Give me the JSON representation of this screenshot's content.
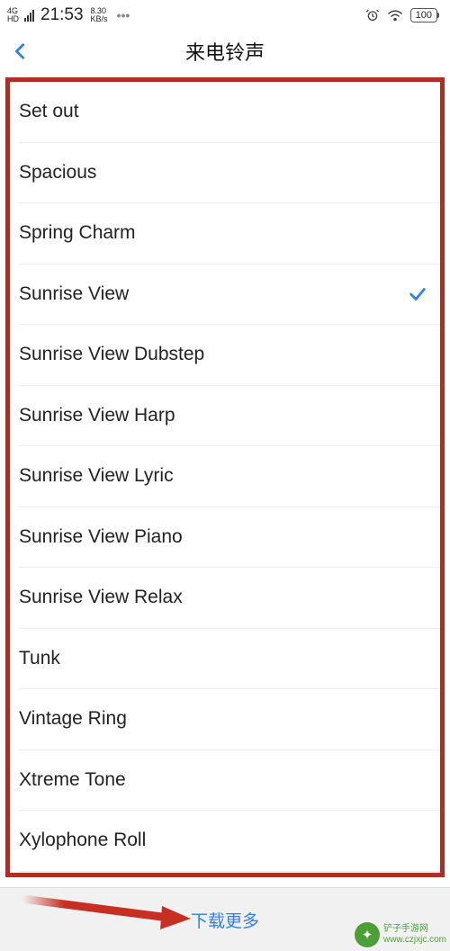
{
  "status": {
    "network_tag_top": "4G",
    "network_tag_bottom": "HD",
    "time": "21:53",
    "speed_top": "8.30",
    "speed_bottom": "KB/s",
    "battery": "100"
  },
  "nav": {
    "title": "来电铃声"
  },
  "ringtones": [
    {
      "label": "Set out",
      "selected": false
    },
    {
      "label": "Spacious",
      "selected": false
    },
    {
      "label": "Spring Charm",
      "selected": false
    },
    {
      "label": "Sunrise View",
      "selected": true
    },
    {
      "label": "Sunrise View Dubstep",
      "selected": false
    },
    {
      "label": "Sunrise View Harp",
      "selected": false
    },
    {
      "label": "Sunrise View Lyric",
      "selected": false
    },
    {
      "label": "Sunrise View Piano",
      "selected": false
    },
    {
      "label": "Sunrise View Relax",
      "selected": false
    },
    {
      "label": "Tunk",
      "selected": false
    },
    {
      "label": "Vintage Ring",
      "selected": false
    },
    {
      "label": "Xtreme Tone",
      "selected": false
    },
    {
      "label": "Xylophone Roll",
      "selected": false
    }
  ],
  "bottom": {
    "download_more": "下载更多"
  },
  "watermark": {
    "site_top": "铲子手游网",
    "site_bottom": "www.czjxjc.com"
  }
}
